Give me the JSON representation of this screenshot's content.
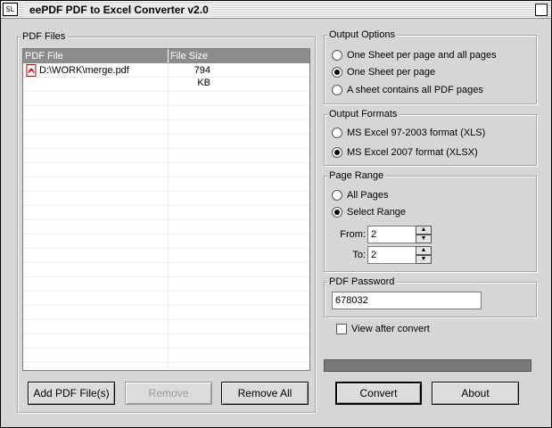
{
  "window": {
    "title": "eePDF PDF to Excel Converter v2.0",
    "icon_text": "SL"
  },
  "pdf_files": {
    "group_label": "PDF Files",
    "columns": [
      "PDF File",
      "File Size"
    ],
    "rows": [
      {
        "file": "D:\\WORK\\merge.pdf",
        "size": "794 KB"
      }
    ],
    "add_button": "Add PDF File(s)",
    "remove_button": "Remove",
    "remove_all_button": "Remove All"
  },
  "output_options": {
    "group_label": "Output Options",
    "options": [
      "One Sheet per page and all pages",
      "One Sheet per page",
      "A sheet contains all PDF pages"
    ],
    "selected": 1
  },
  "output_formats": {
    "group_label": "Output Formats",
    "options": [
      "MS Excel 97-2003 format (XLS)",
      "MS Excel 2007 format (XLSX)"
    ],
    "selected": 1
  },
  "page_range": {
    "group_label": "Page Range",
    "options": [
      "All Pages",
      "Select Range"
    ],
    "selected": 1,
    "from_label": "From:",
    "from_value": "2",
    "to_label": "To:",
    "to_value": "2"
  },
  "pdf_password": {
    "group_label": "PDF Password",
    "value": "678032"
  },
  "view_after_convert": {
    "label": "View after convert",
    "checked": false
  },
  "progress": {
    "value": 0
  },
  "buttons": {
    "convert": "Convert",
    "about": "About"
  },
  "colors": {
    "window_bg": "#d6d6d6",
    "list_header_bg": "#8c8c8c",
    "progress_bg": "#7a7a7a"
  },
  "icons": {
    "file_type": "pdf-file-icon",
    "close": "close-icon",
    "app": "app-icon"
  }
}
